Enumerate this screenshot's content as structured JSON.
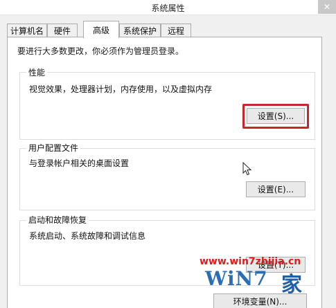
{
  "window": {
    "title": "系统属性",
    "close_symbol": "✕"
  },
  "tabs": [
    {
      "label": "计算机名"
    },
    {
      "label": "硬件"
    },
    {
      "label": "高级",
      "active": true
    },
    {
      "label": "系统保护"
    },
    {
      "label": "远程"
    }
  ],
  "notice": "要进行大多数更改，你必须作为管理员登录。",
  "performance": {
    "title": "性能",
    "description": "视觉效果，处理器计划，内存使用，以及虚拟内存",
    "button": "设置(S)..."
  },
  "user_profiles": {
    "title": "用户配置文件",
    "description": "与登录帐户相关的桌面设置",
    "button": "设置(E)..."
  },
  "startup_recovery": {
    "title": "启动和故障恢复",
    "description": "系统启动、系统故障和调试信息",
    "button": "设置(T)..."
  },
  "env_button": "环境变量(N)...",
  "watermark": {
    "url": "www.win7zhijia.cn",
    "logo": "WiN7",
    "suffix": "家"
  },
  "colors": {
    "highlight": "#c8252c",
    "watermark_red": "#e01b1b",
    "watermark_blue": "#2a6fb4"
  }
}
